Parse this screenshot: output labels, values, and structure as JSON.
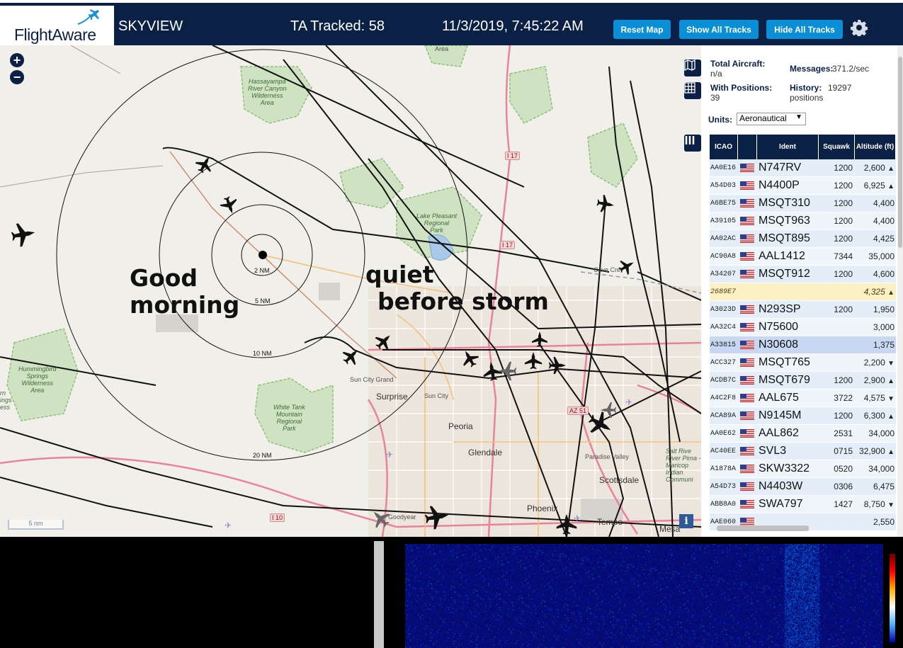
{
  "header": {
    "logo_text": "FlightAware",
    "app_name": "SKYVIEW",
    "tracked": "TA Tracked: 58",
    "datetime": "11/3/2019, 7:45:22 AM",
    "buttons": {
      "reset_map": "Reset Map",
      "show_all": "Show All Tracks",
      "hide_all": "Hide All Tracks"
    },
    "colors": {
      "header_bg": "#0b2045",
      "button_bg": "#0a8fd6"
    }
  },
  "map": {
    "zoom_in": "+",
    "zoom_out": "−",
    "annotations": [
      "Good",
      "morning",
      "quiet",
      "before storm"
    ],
    "range_rings": [
      "2 NM",
      "5 NM",
      "10 NM",
      "20 NM"
    ],
    "scale": "5 nm",
    "places": {
      "sun_city_grand": "Sun City Grand",
      "surprise": "Surprise",
      "sun_city": "Sun City",
      "peoria": "Peoria",
      "glendale": "Glendale",
      "paradise_valley": "Paradise Valley",
      "scottsdale": "Scottsdale",
      "phoenix": "Phoenix",
      "tempe": "Tempe",
      "mesa": "Mesa",
      "goodyear": "Goodyear",
      "cave_creek": "Cave Cre",
      "area": "Area"
    },
    "parks": {
      "hassayampa": [
        "Hassayampa",
        "River Canyon",
        "Wilderness",
        "Area"
      ],
      "lake_pleasant": [
        "Lake Pleasant",
        "Regional",
        "Park"
      ],
      "hummingbird": [
        "Hummingbird",
        "Springs",
        "Wilderness",
        "Area"
      ],
      "white_tank": [
        "White Tank",
        "Mountain",
        "Regional",
        "Park"
      ],
      "salt_river": [
        "Salt Rive",
        "River Pima -",
        "Maricop",
        "Indian",
        "Communi"
      ],
      "edge": [
        "rn",
        "ings",
        "ess"
      ]
    },
    "highways": [
      "I 17",
      "I 17",
      "AZ 51",
      "I 10"
    ],
    "info": "i"
  },
  "sidebar": {
    "total_aircraft_label": "Total Aircraft:",
    "total_aircraft_value": "n/a",
    "messages_label": "Messages:",
    "messages_value": "371.2/sec",
    "with_positions_label": "With Positions:",
    "with_positions_value": "39",
    "history_label": "History:",
    "history_value": "19297",
    "history_unit": "positions",
    "units_label": "Units:",
    "units_value": "Aeronautical",
    "columns": [
      "ICAO",
      "Ident",
      "Squawk",
      "Altitude (ft)"
    ],
    "rows": [
      {
        "icao": "AA0E16",
        "flag": true,
        "ident": "N747RV",
        "squawk": "1200",
        "alt": "2,600",
        "trend": "▲"
      },
      {
        "icao": "A54D03",
        "flag": true,
        "ident": "N4400P",
        "squawk": "1200",
        "alt": "6,925",
        "trend": "▲"
      },
      {
        "icao": "A6BE75",
        "flag": true,
        "ident": "MSQT310",
        "squawk": "1200",
        "alt": "4,400",
        "trend": ""
      },
      {
        "icao": "A39105",
        "flag": true,
        "ident": "MSQT963",
        "squawk": "1200",
        "alt": "4,400",
        "trend": ""
      },
      {
        "icao": "AA02AC",
        "flag": true,
        "ident": "MSQT895",
        "squawk": "1200",
        "alt": "4,425",
        "trend": ""
      },
      {
        "icao": "AC90A8",
        "flag": true,
        "ident": "AAL1412",
        "squawk": "7344",
        "alt": "35,000",
        "trend": ""
      },
      {
        "icao": "A34207",
        "flag": true,
        "ident": "MSQT912",
        "squawk": "1200",
        "alt": "4,600",
        "trend": ""
      },
      {
        "icao": "2689E7",
        "flag": false,
        "ident": "",
        "squawk": "",
        "alt": "4,325",
        "trend": "▲"
      },
      {
        "icao": "A3023D",
        "flag": true,
        "ident": "N293SP",
        "squawk": "1200",
        "alt": "1,950",
        "trend": ""
      },
      {
        "icao": "AA32C4",
        "flag": true,
        "ident": "N75600",
        "squawk": "",
        "alt": "3,000",
        "trend": ""
      },
      {
        "icao": "A33815",
        "flag": true,
        "ident": "N30608",
        "squawk": "",
        "alt": "1,375",
        "trend": ""
      },
      {
        "icao": "ACC327",
        "flag": true,
        "ident": "MSQT765",
        "squawk": "",
        "alt": "2,200",
        "trend": "▼"
      },
      {
        "icao": "ACDB7C",
        "flag": true,
        "ident": "MSQT679",
        "squawk": "1200",
        "alt": "2,900",
        "trend": "▲"
      },
      {
        "icao": "A4C2F8",
        "flag": true,
        "ident": "AAL675",
        "squawk": "3722",
        "alt": "4,575",
        "trend": "▼"
      },
      {
        "icao": "ACA89A",
        "flag": true,
        "ident": "N9145M",
        "squawk": "1200",
        "alt": "6,300",
        "trend": "▲"
      },
      {
        "icao": "AA0E62",
        "flag": true,
        "ident": "AAL862",
        "squawk": "2531",
        "alt": "34,000",
        "trend": ""
      },
      {
        "icao": "AC40EE",
        "flag": true,
        "ident": "SVL3",
        "squawk": "0715",
        "alt": "32,900",
        "trend": "▲"
      },
      {
        "icao": "A1878A",
        "flag": true,
        "ident": "SKW3322",
        "squawk": "0520",
        "alt": "34,000",
        "trend": ""
      },
      {
        "icao": "A54D73",
        "flag": true,
        "ident": "N4403W",
        "squawk": "0306",
        "alt": "6,475",
        "trend": ""
      },
      {
        "icao": "ABB8A0",
        "flag": true,
        "ident": "SWA797",
        "squawk": "1427",
        "alt": "8,750",
        "trend": "▼"
      },
      {
        "icao": "AAE060",
        "flag": true,
        "ident": "",
        "squawk": "",
        "alt": "2,550",
        "trend": ""
      }
    ]
  }
}
